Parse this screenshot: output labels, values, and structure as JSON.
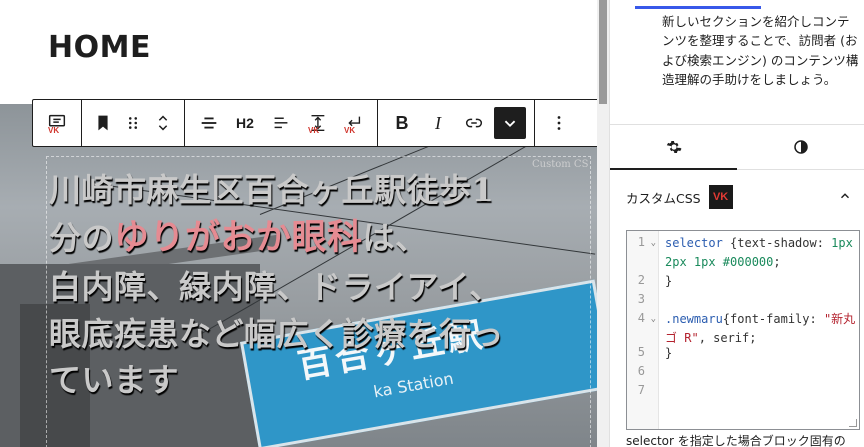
{
  "editor": {
    "page_title": "HOME",
    "heading": {
      "line1": "川崎市麻生区百合ヶ丘駅徒歩1",
      "line2_pre": "分の",
      "line2_highlight": "ゆりがおか眼科",
      "line2_post": "は、",
      "line3": "白内障、緑内障、ドライアイ、",
      "line4": "眼底疾患など幅広く診療を行っ",
      "line5": "ています"
    },
    "watermark": "Custom CS",
    "station_sign": {
      "kanji": "百合ヶ丘駅",
      "roman": "ka Station"
    }
  },
  "toolbar": {
    "h2_label": "H2",
    "bold_label": "B",
    "italic_label": "I",
    "vk_badge": "VK"
  },
  "sidebar": {
    "description": "新しいセクションを紹介しコンテンツを整理することで、訪問者 (および検索エンジン) のコンテンツ構造理解の手助けをしましょう。",
    "css_panel_title": "カスタムCSS",
    "css_logo_text": "VK",
    "code_lines": [
      {
        "num": "1",
        "fold": true
      },
      {
        "num": "2",
        "fold": false
      },
      {
        "num": "3",
        "fold": false
      },
      {
        "num": "4",
        "fold": true
      },
      {
        "num": "5",
        "fold": false
      },
      {
        "num": "6",
        "fold": false
      },
      {
        "num": "7",
        "fold": false
      }
    ],
    "code": {
      "l1_selector": "selector",
      "l1_rest": " {text-shadow: ",
      "l1_val": "1px 2px 1px #000000",
      "l1_end": ";",
      "l2": "}",
      "l4_selector": ".newmaru",
      "l4_prop": "{font-family: ",
      "l4_str": "\"新丸ゴ R\"",
      "l4_end": ", serif;",
      "l5": "}"
    },
    "help_text": "selector を指定した場合ブロック固有の"
  },
  "colors": {
    "accent": "#3858e9",
    "text": "#1e1e1e",
    "heading_highlight": "#e58b92",
    "code_string": "#b4232f",
    "code_keyword": "#2b5db0"
  }
}
